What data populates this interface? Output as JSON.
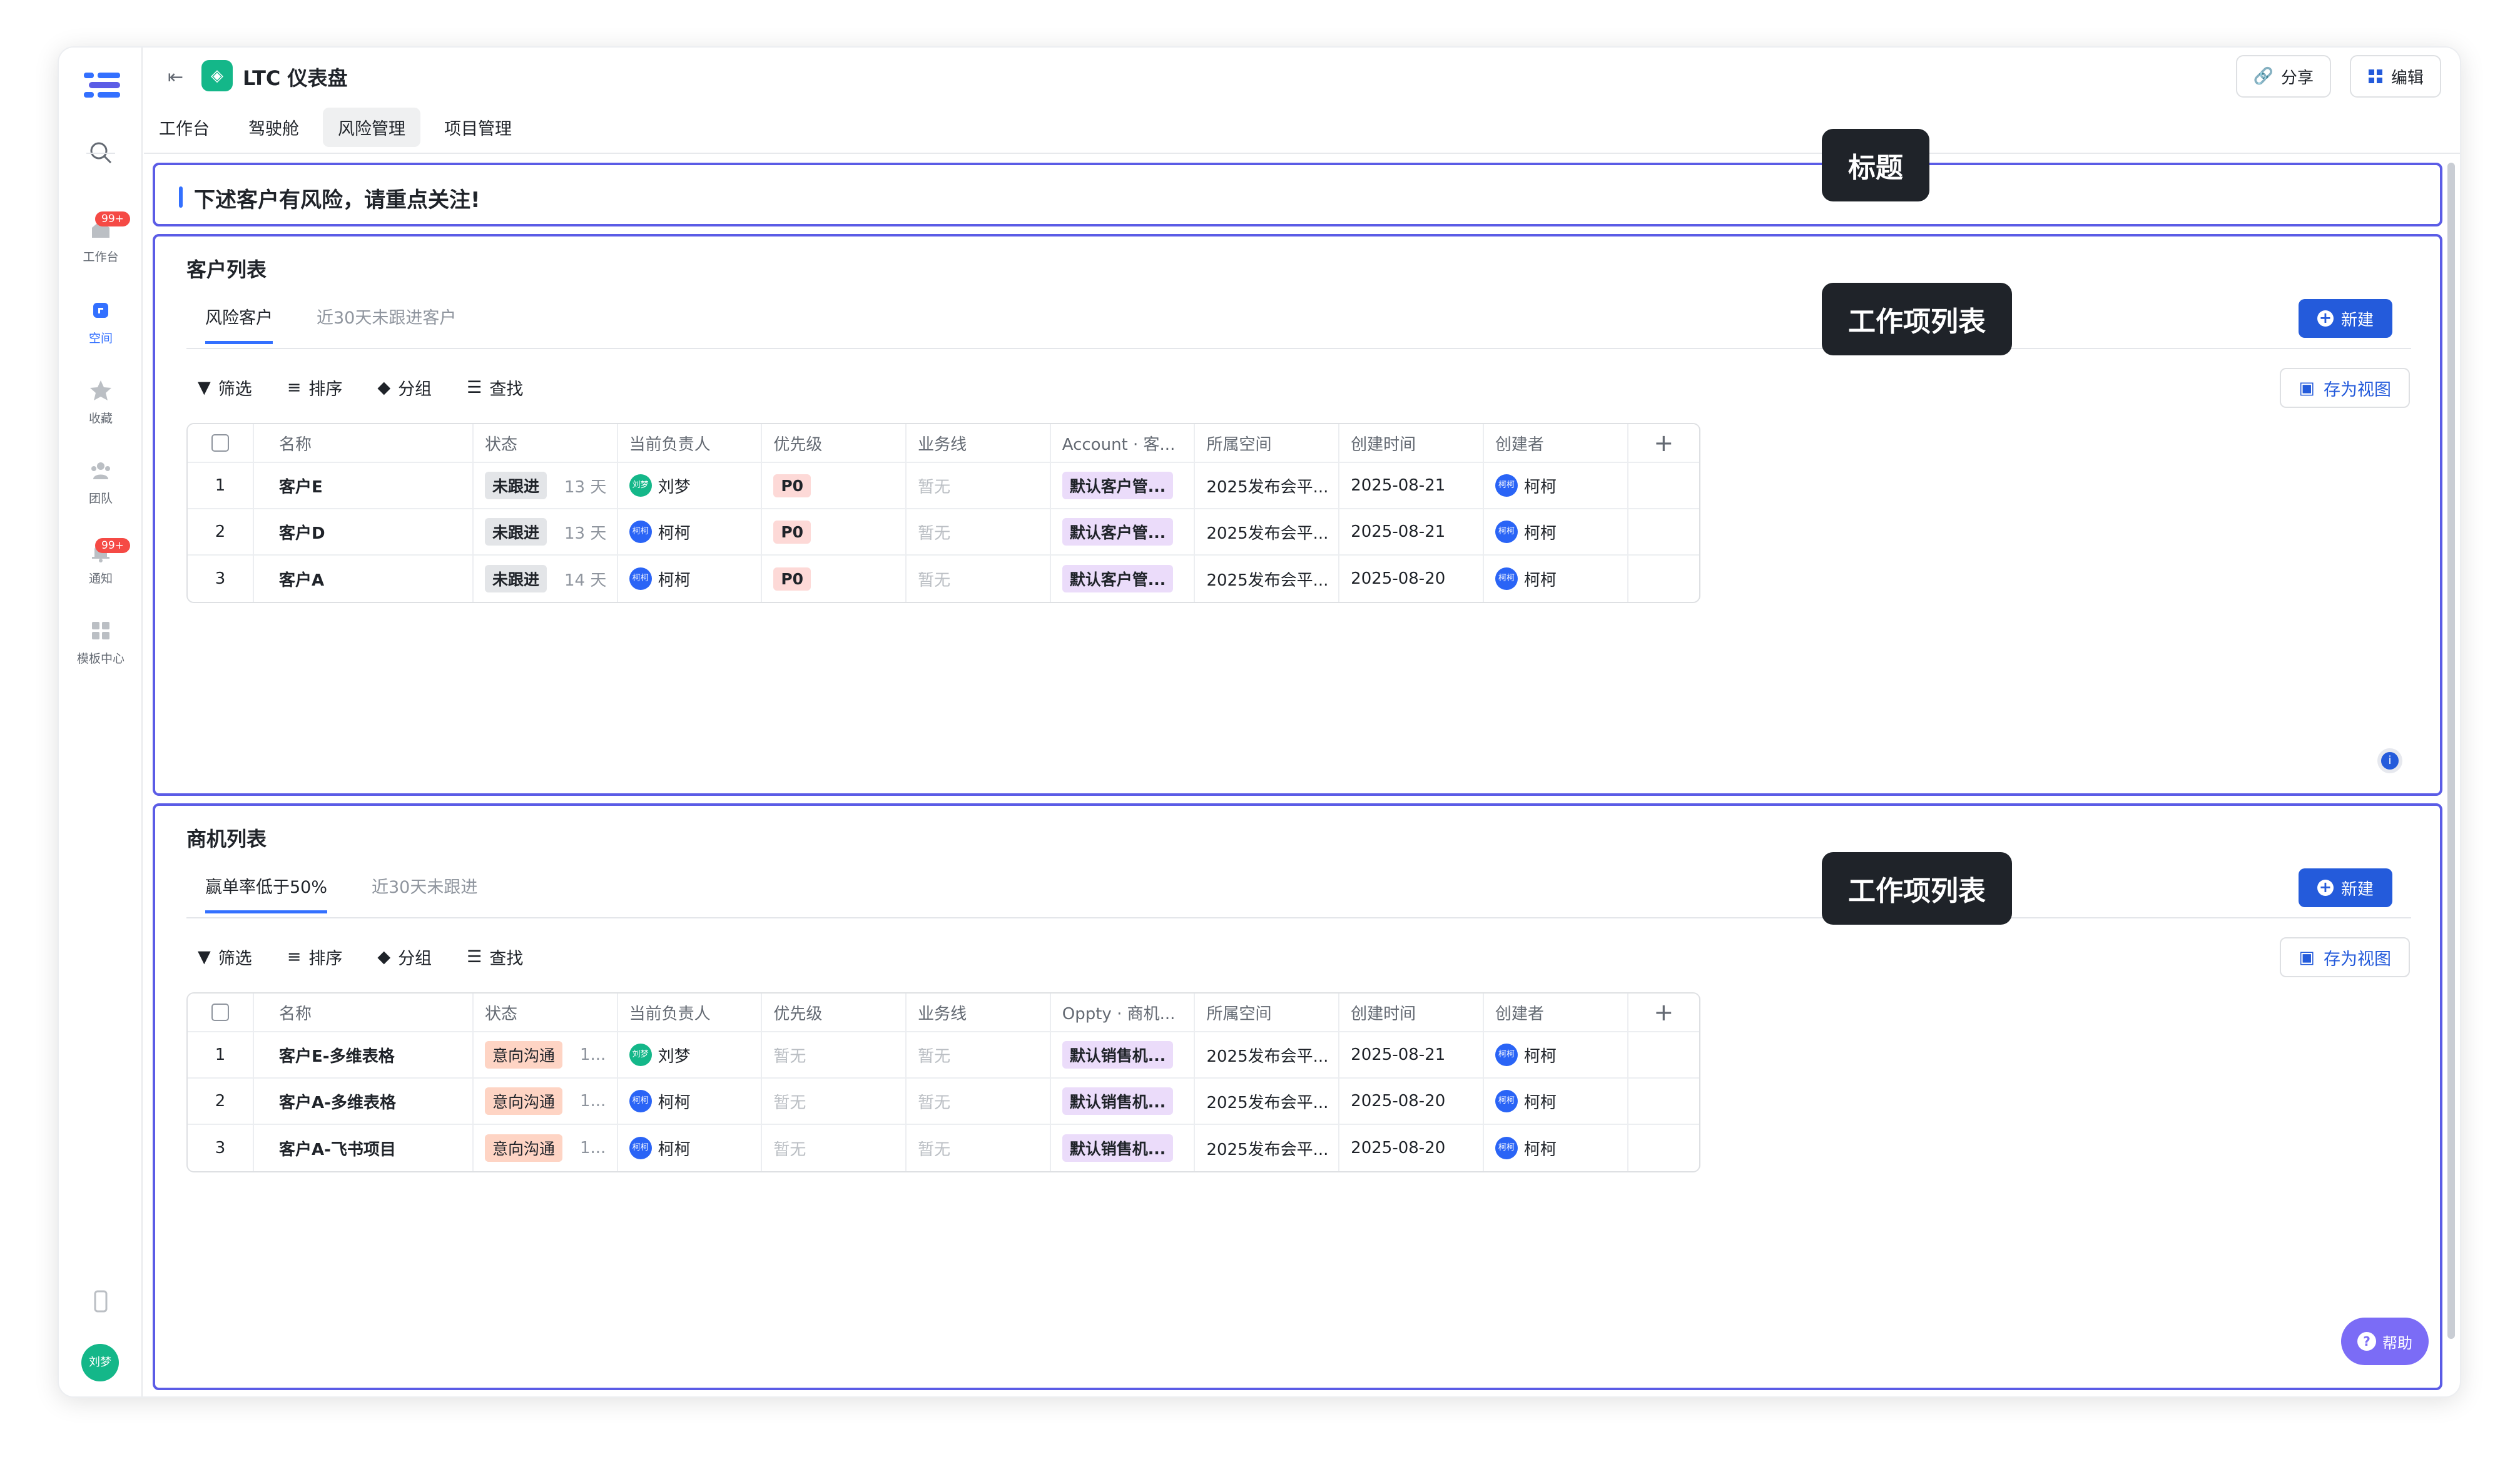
{
  "app": {
    "title": "LTC 仪表盘",
    "share_label": "分享",
    "edit_label": "编辑",
    "help_label": "帮助",
    "user_avatar": "刘梦"
  },
  "rail": {
    "items": [
      {
        "label": "工作台",
        "badge": "99+",
        "icon": "home-icon"
      },
      {
        "label": "空间",
        "icon": "space-icon",
        "active": true
      },
      {
        "label": "收藏",
        "icon": "star-icon"
      },
      {
        "label": "团队",
        "icon": "team-icon"
      },
      {
        "label": "通知",
        "badge": "99+",
        "icon": "bell-icon"
      },
      {
        "label": "模板中心",
        "icon": "template-icon"
      }
    ]
  },
  "tabs": [
    "工作台",
    "驾驶舱",
    "风险管理",
    "项目管理"
  ],
  "notice": "下述客户有风险，请重点关注!",
  "tips": {
    "t1": "标题",
    "t2": "工作项列表",
    "t3": "工作项列表"
  },
  "toolbar": {
    "filter": "筛选",
    "sort": "排序",
    "group": "分组",
    "search": "查找",
    "save_view": "存为视图",
    "new": "新建"
  },
  "customers": {
    "title": "客户列表",
    "tabs": [
      "风险客户",
      "近30天未跟进客户"
    ],
    "headers": [
      "名称",
      "状态",
      "当前负责人",
      "优先级",
      "业务线",
      "Account · 客...",
      "所属空间",
      "创建时间",
      "创建者"
    ],
    "rows": [
      {
        "no": "1",
        "name": "客户E",
        "status": "未跟进",
        "days": "13 天",
        "owner": "刘梦",
        "owner_avatar": "刘梦",
        "priority": "P0",
        "line": "暂无",
        "account": "默认客户管...",
        "space": "2025发布会平...",
        "created": "2025-08-21",
        "creator": "柯柯",
        "creator_avatar": "柯柯"
      },
      {
        "no": "2",
        "name": "客户D",
        "status": "未跟进",
        "days": "13 天",
        "owner": "柯柯",
        "owner_avatar": "柯柯",
        "priority": "P0",
        "line": "暂无",
        "account": "默认客户管...",
        "space": "2025发布会平...",
        "created": "2025-08-21",
        "creator": "柯柯",
        "creator_avatar": "柯柯"
      },
      {
        "no": "3",
        "name": "客户A",
        "status": "未跟进",
        "days": "14 天",
        "owner": "柯柯",
        "owner_avatar": "柯柯",
        "priority": "P0",
        "line": "暂无",
        "account": "默认客户管...",
        "space": "2025发布会平...",
        "created": "2025-08-20",
        "creator": "柯柯",
        "creator_avatar": "柯柯"
      }
    ]
  },
  "opps": {
    "title": "商机列表",
    "tabs": [
      "赢单率低于50%",
      "近30天未跟进"
    ],
    "headers": [
      "名称",
      "状态",
      "当前负责人",
      "优先级",
      "业务线",
      "Oppty · 商机...",
      "所属空间",
      "创建时间",
      "创建者"
    ],
    "rows": [
      {
        "no": "1",
        "name": "客户E-多维表格",
        "status": "意向沟通",
        "days": "1...",
        "owner": "刘梦",
        "owner_avatar": "刘梦",
        "priority": "暂无",
        "line": "暂无",
        "account": "默认销售机...",
        "space": "2025发布会平...",
        "created": "2025-08-21",
        "creator": "柯柯",
        "creator_avatar": "柯柯"
      },
      {
        "no": "2",
        "name": "客户A-多维表格",
        "status": "意向沟通",
        "days": "1...",
        "owner": "柯柯",
        "owner_avatar": "柯柯",
        "priority": "暂无",
        "line": "暂无",
        "account": "默认销售机...",
        "space": "2025发布会平...",
        "created": "2025-08-20",
        "creator": "柯柯",
        "creator_avatar": "柯柯"
      },
      {
        "no": "3",
        "name": "客户A-飞书项目",
        "status": "意向沟通",
        "days": "1...",
        "owner": "柯柯",
        "owner_avatar": "柯柯",
        "priority": "暂无",
        "line": "暂无",
        "account": "默认销售机...",
        "space": "2025发布会平...",
        "created": "2025-08-20",
        "creator": "柯柯",
        "creator_avatar": "柯柯"
      }
    ]
  }
}
